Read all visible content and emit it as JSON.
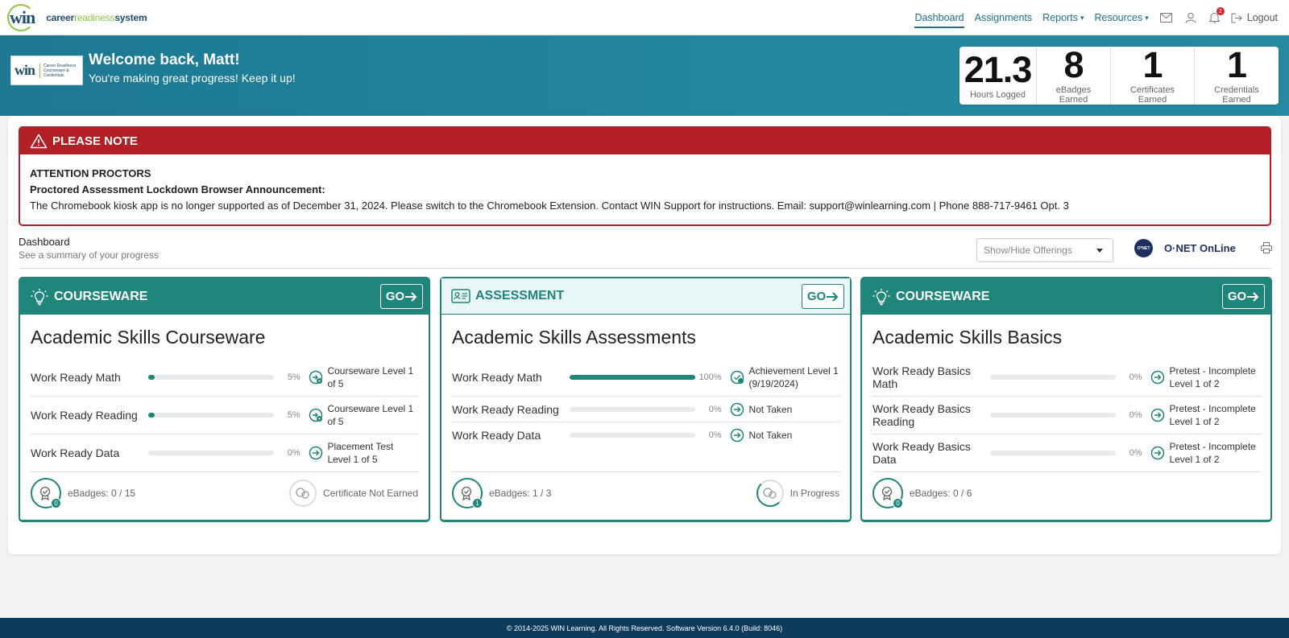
{
  "brand": {
    "logo_mark": "win",
    "logo_prefix": "career",
    "logo_mid": "readiness",
    "logo_suffix": "system"
  },
  "nav": {
    "dashboard": "Dashboard",
    "assignments": "Assignments",
    "reports": "Reports",
    "resources": "Resources",
    "notifications_count": "2",
    "logout": "Logout"
  },
  "hero": {
    "logo_mark": "win",
    "logo_text": "Career Readiness Courseware & Credentials",
    "welcome": "Welcome back, Matt!",
    "subtitle": "You're making great progress! Keep it up!",
    "stats": [
      {
        "value": "21.3",
        "label": "Hours Logged"
      },
      {
        "value": "8",
        "label": "eBadges Earned"
      },
      {
        "value": "1",
        "label": "Certificates Earned"
      },
      {
        "value": "1",
        "label": "Credentials Earned"
      }
    ]
  },
  "notice": {
    "heading": "PLEASE NOTE",
    "line1": "ATTENTION PROCTORS",
    "line2": "Proctored Assessment Lockdown Browser Announcement:",
    "line3": "The Chromebook kiosk app is no longer supported as of December 31, 2024. Please switch to the Chromebook Extension. Contact WIN Support for instructions. Email: support@winlearning.com | Phone 888-717-9461 Opt. 3"
  },
  "dashboard": {
    "title": "Dashboard",
    "subtitle": "See a summary of your progress",
    "offerings_placeholder": "Show/Hide Offerings",
    "onet_badge": "O*NET",
    "onet_label": "O·NET OnLine"
  },
  "cards": [
    {
      "category": "COURSEWARE",
      "go": "GO",
      "title": "Academic Skills Courseware",
      "rows": [
        {
          "name": "Work Ready Math",
          "progress": 5,
          "pct": "5%",
          "status": "Courseware Level 1 of 5"
        },
        {
          "name": "Work Ready Reading",
          "progress": 5,
          "pct": "5%",
          "status": "Courseware Level 1 of 5"
        },
        {
          "name": "Work Ready Data",
          "progress": 0,
          "pct": "0%",
          "status": "Placement Test Level 1 of 5"
        }
      ],
      "ebadges_count": "0",
      "ebadges": "eBadges: 0 / 15",
      "cert": "Certificate Not Earned"
    },
    {
      "category": "ASSESSMENT",
      "go": "GO",
      "title": "Academic Skills Assessments",
      "rows": [
        {
          "name": "Work Ready Math",
          "progress": 100,
          "pct": "100%",
          "status": "Achievement Level 1 (9/19/2024)"
        },
        {
          "name": "Work Ready Reading",
          "progress": 0,
          "pct": "0%",
          "status": "Not Taken"
        },
        {
          "name": "Work Ready Data",
          "progress": 0,
          "pct": "0%",
          "status": "Not Taken"
        }
      ],
      "ebadges_count": "1",
      "ebadges": "eBadges: 1 / 3",
      "cert": "In Progress"
    },
    {
      "category": "COURSEWARE",
      "go": "GO",
      "title": "Academic Skills Basics",
      "rows": [
        {
          "name": "Work Ready Basics Math",
          "progress": 0,
          "pct": "0%",
          "status": "Pretest - Incomplete Level 1 of 2"
        },
        {
          "name": "Work Ready Basics Reading",
          "progress": 0,
          "pct": "0%",
          "status": "Pretest - Incomplete Level 1 of 2"
        },
        {
          "name": "Work Ready Basics Data",
          "progress": 0,
          "pct": "0%",
          "status": "Pretest - Incomplete Level 1 of 2"
        }
      ],
      "ebadges_count": "0",
      "ebadges": "eBadges: 0 / 6",
      "cert": ""
    }
  ],
  "footer": "© 2014-2025 WIN Learning. All Rights Reserved. Software Version 6.4.0 (Build: 8046)",
  "colors": {
    "teal": "#20857a",
    "header_blue": "#1f7f99",
    "alert_red": "#b21f24",
    "footer_navy": "#0e3a5c"
  }
}
